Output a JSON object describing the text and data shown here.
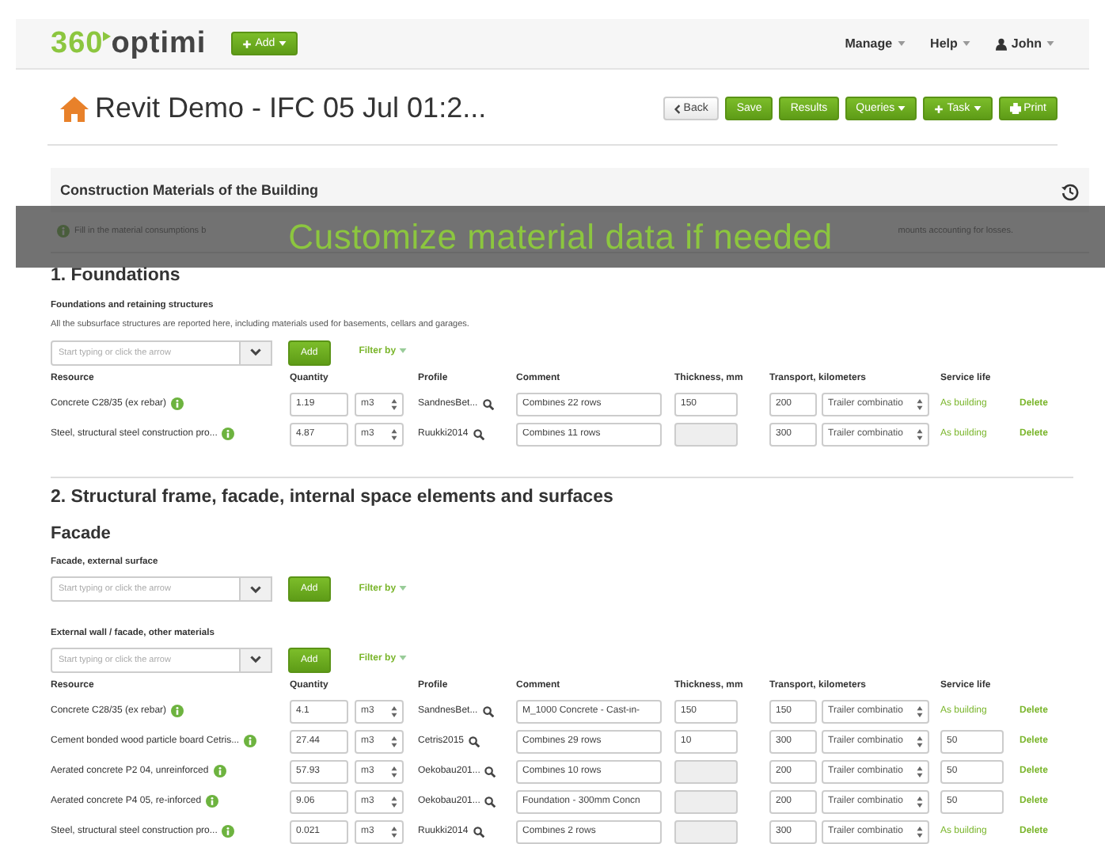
{
  "navbar": {
    "logo": {
      "number": "360",
      "name": "optimi"
    },
    "add_button": {
      "label": "Add"
    },
    "menus": [
      {
        "label": "Manage",
        "kind": "menu"
      },
      {
        "label": "Help",
        "kind": "menu"
      },
      {
        "label": "John",
        "kind": "user"
      }
    ]
  },
  "page": {
    "title": "Revit Demo - IFC 05 Jul 01:2...",
    "buttons": [
      {
        "label": "Back",
        "kind": "back",
        "caret": false
      },
      {
        "label": "Save",
        "kind": "plain",
        "caret": false
      },
      {
        "label": "Results",
        "kind": "plain",
        "caret": false
      },
      {
        "label": "Queries",
        "kind": "plain",
        "caret": true
      },
      {
        "label": "Task",
        "kind": "add",
        "caret": true
      },
      {
        "label": "Print",
        "kind": "print",
        "caret": false
      }
    ]
  },
  "panel": {
    "title": "Construction Materials of the Building",
    "info_left": "Fill in the material consumptions b",
    "info_right": "mounts accounting for losses."
  },
  "caption": "Customize material data if needed",
  "sections": [
    {
      "title": "1. Foundations",
      "subsections": [
        {
          "groups": [
            {
              "title": "Foundations and retaining structures",
              "description": "All the subsurface structures are reported here, including materials used for basements, cellars and garages.",
              "picker": {
                "placeholder": "Start typing or click the arrow",
                "add": "Add",
                "filter": "Filter by"
              },
              "table": {
                "columns": [
                  "Resource",
                  "Quantity",
                  "Profile",
                  "Comment",
                  "Thickness, mm",
                  "Transport, kilometers",
                  "Service life"
                ],
                "rows": [
                  {
                    "resource": "Concrete C28/35 (ex rebar)",
                    "quantity": "1.19",
                    "unit": "m3",
                    "profile": "SandnesBet...",
                    "comment": "Combines 22 rows",
                    "thickness": {
                      "value": "150",
                      "disabled": false
                    },
                    "transport": "200",
                    "vehicle": "Trailer combinatio",
                    "service": {
                      "kind": "link",
                      "text": "As building"
                    },
                    "delete": "Delete"
                  },
                  {
                    "resource": "Steel, structural steel construction pro...",
                    "quantity": "4.87",
                    "unit": "m3",
                    "profile": "Ruukki2014",
                    "comment": "Combines 11 rows",
                    "thickness": {
                      "disabled": true
                    },
                    "transport": "300",
                    "vehicle": "Trailer combinatio",
                    "service": {
                      "kind": "link",
                      "text": "As building"
                    },
                    "delete": "Delete"
                  }
                ]
              }
            }
          ]
        }
      ]
    },
    {
      "title": "2. Structural frame, facade, internal space elements and surfaces",
      "subsections": [
        {
          "heading": "Facade",
          "groups": [
            {
              "title": "Facade, external surface",
              "picker": {
                "placeholder": "Start typing or click the arrow",
                "add": "Add",
                "filter": "Filter by"
              }
            },
            {
              "title": "External wall / facade, other materials",
              "picker": {
                "placeholder": "Start typing or click the arrow",
                "add": "Add",
                "filter": "Filter by"
              },
              "table": {
                "columns": [
                  "Resource",
                  "Quantity",
                  "Profile",
                  "Comment",
                  "Thickness, mm",
                  "Transport, kilometers",
                  "Service life"
                ],
                "rows": [
                  {
                    "resource": "Concrete C28/35 (ex rebar)",
                    "quantity": "4.1",
                    "unit": "m3",
                    "profile": "SandnesBet...",
                    "comment": "M_1000 Concrete - Cast-in-",
                    "thickness": {
                      "value": "150",
                      "disabled": false
                    },
                    "transport": "150",
                    "vehicle": "Trailer combinatio",
                    "service": {
                      "kind": "link",
                      "text": "As building"
                    },
                    "delete": "Delete"
                  },
                  {
                    "resource": "Cement bonded wood particle board Cetris...",
                    "quantity": "27.44",
                    "unit": "m3",
                    "profile": "Cetris2015",
                    "comment": "Combines 29 rows",
                    "thickness": {
                      "value": "10",
                      "disabled": false
                    },
                    "transport": "300",
                    "vehicle": "Trailer combinatio",
                    "service": {
                      "kind": "field",
                      "text": "50"
                    },
                    "delete": "Delete"
                  },
                  {
                    "resource": "Aerated concrete P2 04, unreinforced",
                    "quantity": "57.93",
                    "unit": "m3",
                    "profile": "Oekobau201...",
                    "comment": "Combines 10 rows",
                    "thickness": {
                      "disabled": true
                    },
                    "transport": "200",
                    "vehicle": "Trailer combinatio",
                    "service": {
                      "kind": "field",
                      "text": "50"
                    },
                    "delete": "Delete"
                  },
                  {
                    "resource": "Aerated concrete P4 05, re-inforced",
                    "quantity": "9.06",
                    "unit": "m3",
                    "profile": "Oekobau201...",
                    "comment": "Foundation - 300mm Concn",
                    "thickness": {
                      "disabled": true
                    },
                    "transport": "200",
                    "vehicle": "Trailer combinatio",
                    "service": {
                      "kind": "field",
                      "text": "50"
                    },
                    "delete": "Delete"
                  },
                  {
                    "resource": "Steel, structural steel construction pro...",
                    "quantity": "0.021",
                    "unit": "m3",
                    "profile": "Ruukki2014",
                    "comment": "Combines 2 rows",
                    "thickness": {
                      "disabled": true
                    },
                    "transport": "300",
                    "vehicle": "Trailer combinatio",
                    "service": {
                      "kind": "link",
                      "text": "As building"
                    },
                    "delete": "Delete"
                  }
                ]
              }
            }
          ]
        }
      ]
    }
  ]
}
